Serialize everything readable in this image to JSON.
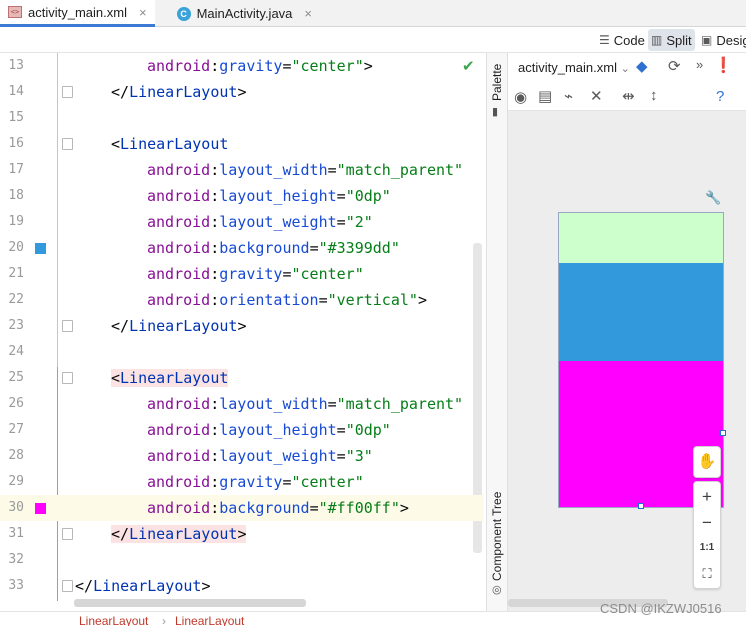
{
  "tabs": [
    {
      "label": "activity_main.xml",
      "active": true
    },
    {
      "label": "MainActivity.java",
      "active": false
    }
  ],
  "view_modes": {
    "code": "Code",
    "split": "Split",
    "design": "Desig"
  },
  "editor": {
    "lines": [
      {
        "num": "13",
        "tokens": [
          {
            "t": "ns",
            "v": "android"
          },
          {
            "t": "bracket",
            "v": ":"
          },
          {
            "t": "attrname",
            "v": "gravity"
          },
          {
            "t": "bracket",
            "v": "="
          },
          {
            "t": "str",
            "v": "\"center\""
          },
          {
            "t": "bracket",
            "v": ">"
          }
        ],
        "indent": 147
      },
      {
        "num": "14",
        "tokens": [
          {
            "t": "bracket",
            "v": "</"
          },
          {
            "t": "tagname",
            "v": "LinearLayout"
          },
          {
            "t": "bracket",
            "v": ">"
          }
        ],
        "indent": 111
      },
      {
        "num": "15",
        "tokens": [],
        "indent": 111
      },
      {
        "num": "16",
        "tokens": [
          {
            "t": "bracket",
            "v": "<"
          },
          {
            "t": "tagname",
            "v": "LinearLayout"
          }
        ],
        "indent": 111
      },
      {
        "num": "17",
        "tokens": [
          {
            "t": "ns",
            "v": "android"
          },
          {
            "t": "bracket",
            "v": ":"
          },
          {
            "t": "attrname",
            "v": "layout_width"
          },
          {
            "t": "bracket",
            "v": "="
          },
          {
            "t": "str",
            "v": "\"match_parent\""
          }
        ],
        "indent": 147
      },
      {
        "num": "18",
        "tokens": [
          {
            "t": "ns",
            "v": "android"
          },
          {
            "t": "bracket",
            "v": ":"
          },
          {
            "t": "attrname",
            "v": "layout_height"
          },
          {
            "t": "bracket",
            "v": "="
          },
          {
            "t": "str",
            "v": "\"0dp\""
          }
        ],
        "indent": 147
      },
      {
        "num": "19",
        "tokens": [
          {
            "t": "ns",
            "v": "android"
          },
          {
            "t": "bracket",
            "v": ":"
          },
          {
            "t": "attrname",
            "v": "layout_weight"
          },
          {
            "t": "bracket",
            "v": "="
          },
          {
            "t": "str",
            "v": "\"2\""
          }
        ],
        "indent": 147
      },
      {
        "num": "20",
        "tokens": [
          {
            "t": "ns",
            "v": "android"
          },
          {
            "t": "bracket",
            "v": ":"
          },
          {
            "t": "attrname",
            "v": "background"
          },
          {
            "t": "bracket",
            "v": "="
          },
          {
            "t": "str",
            "v": "\"#3399dd\""
          }
        ],
        "indent": 147
      },
      {
        "num": "21",
        "tokens": [
          {
            "t": "ns",
            "v": "android"
          },
          {
            "t": "bracket",
            "v": ":"
          },
          {
            "t": "attrname",
            "v": "gravity"
          },
          {
            "t": "bracket",
            "v": "="
          },
          {
            "t": "str",
            "v": "\"center\""
          }
        ],
        "indent": 147
      },
      {
        "num": "22",
        "tokens": [
          {
            "t": "ns",
            "v": "android"
          },
          {
            "t": "bracket",
            "v": ":"
          },
          {
            "t": "attrname",
            "v": "orientation"
          },
          {
            "t": "bracket",
            "v": "="
          },
          {
            "t": "str",
            "v": "\"vertical\""
          },
          {
            "t": "bracket",
            "v": ">"
          }
        ],
        "indent": 147
      },
      {
        "num": "23",
        "tokens": [
          {
            "t": "bracket",
            "v": "</"
          },
          {
            "t": "tagname",
            "v": "LinearLayout"
          },
          {
            "t": "bracket",
            "v": ">"
          }
        ],
        "indent": 111
      },
      {
        "num": "24",
        "tokens": [],
        "indent": 111
      },
      {
        "num": "25",
        "tokens": [
          {
            "t": "bracket",
            "v": "<"
          },
          {
            "t": "tagname",
            "v": "LinearLayout"
          }
        ],
        "indent": 111,
        "highlight": true
      },
      {
        "num": "26",
        "tokens": [
          {
            "t": "ns",
            "v": "android"
          },
          {
            "t": "bracket",
            "v": ":"
          },
          {
            "t": "attrname",
            "v": "layout_width"
          },
          {
            "t": "bracket",
            "v": "="
          },
          {
            "t": "str",
            "v": "\"match_parent\""
          }
        ],
        "indent": 147
      },
      {
        "num": "27",
        "tokens": [
          {
            "t": "ns",
            "v": "android"
          },
          {
            "t": "bracket",
            "v": ":"
          },
          {
            "t": "attrname",
            "v": "layout_height"
          },
          {
            "t": "bracket",
            "v": "="
          },
          {
            "t": "str",
            "v": "\"0dp\""
          }
        ],
        "indent": 147
      },
      {
        "num": "28",
        "tokens": [
          {
            "t": "ns",
            "v": "android"
          },
          {
            "t": "bracket",
            "v": ":"
          },
          {
            "t": "attrname",
            "v": "layout_weight"
          },
          {
            "t": "bracket",
            "v": "="
          },
          {
            "t": "str",
            "v": "\"3\""
          }
        ],
        "indent": 147
      },
      {
        "num": "29",
        "tokens": [
          {
            "t": "ns",
            "v": "android"
          },
          {
            "t": "bracket",
            "v": ":"
          },
          {
            "t": "attrname",
            "v": "gravity"
          },
          {
            "t": "bracket",
            "v": "="
          },
          {
            "t": "str",
            "v": "\"center\""
          }
        ],
        "indent": 147
      },
      {
        "num": "30",
        "tokens": [
          {
            "t": "ns",
            "v": "android"
          },
          {
            "t": "bracket",
            "v": ":"
          },
          {
            "t": "attrname",
            "v": "background"
          },
          {
            "t": "bracket",
            "v": "="
          },
          {
            "t": "str",
            "v": "\"#ff00ff\""
          },
          {
            "t": "bracket",
            "v": ">"
          }
        ],
        "indent": 147,
        "current": true
      },
      {
        "num": "31",
        "tokens": [
          {
            "t": "bracket",
            "v": "</"
          },
          {
            "t": "tagname",
            "v": "LinearLayout"
          },
          {
            "t": "bracket",
            "v": ">"
          }
        ],
        "indent": 111,
        "highlight": true
      },
      {
        "num": "32",
        "tokens": [],
        "indent": 111
      },
      {
        "num": "33",
        "tokens": [
          {
            "t": "bracket",
            "v": "</"
          },
          {
            "t": "tagname",
            "v": "LinearLayout"
          },
          {
            "t": "bracket",
            "v": ">"
          }
        ],
        "indent": 75
      }
    ],
    "swatches": {
      "20": "#3399dd",
      "30": "#ff00ff"
    }
  },
  "side_panels": {
    "palette": "Palette",
    "component_tree": "Component Tree"
  },
  "design": {
    "file_dropdown": "activity_main.xml",
    "zoom_actual": "1:1",
    "zoom_in": "+",
    "zoom_out": "−",
    "preview_colors": {
      "top": "#ccffcc",
      "middle": "#3399dd",
      "bottom": "#ff00ff"
    }
  },
  "breadcrumb": [
    "LinearLayout",
    "LinearLayout"
  ],
  "watermark": "CSDN @IKZWJ0516"
}
